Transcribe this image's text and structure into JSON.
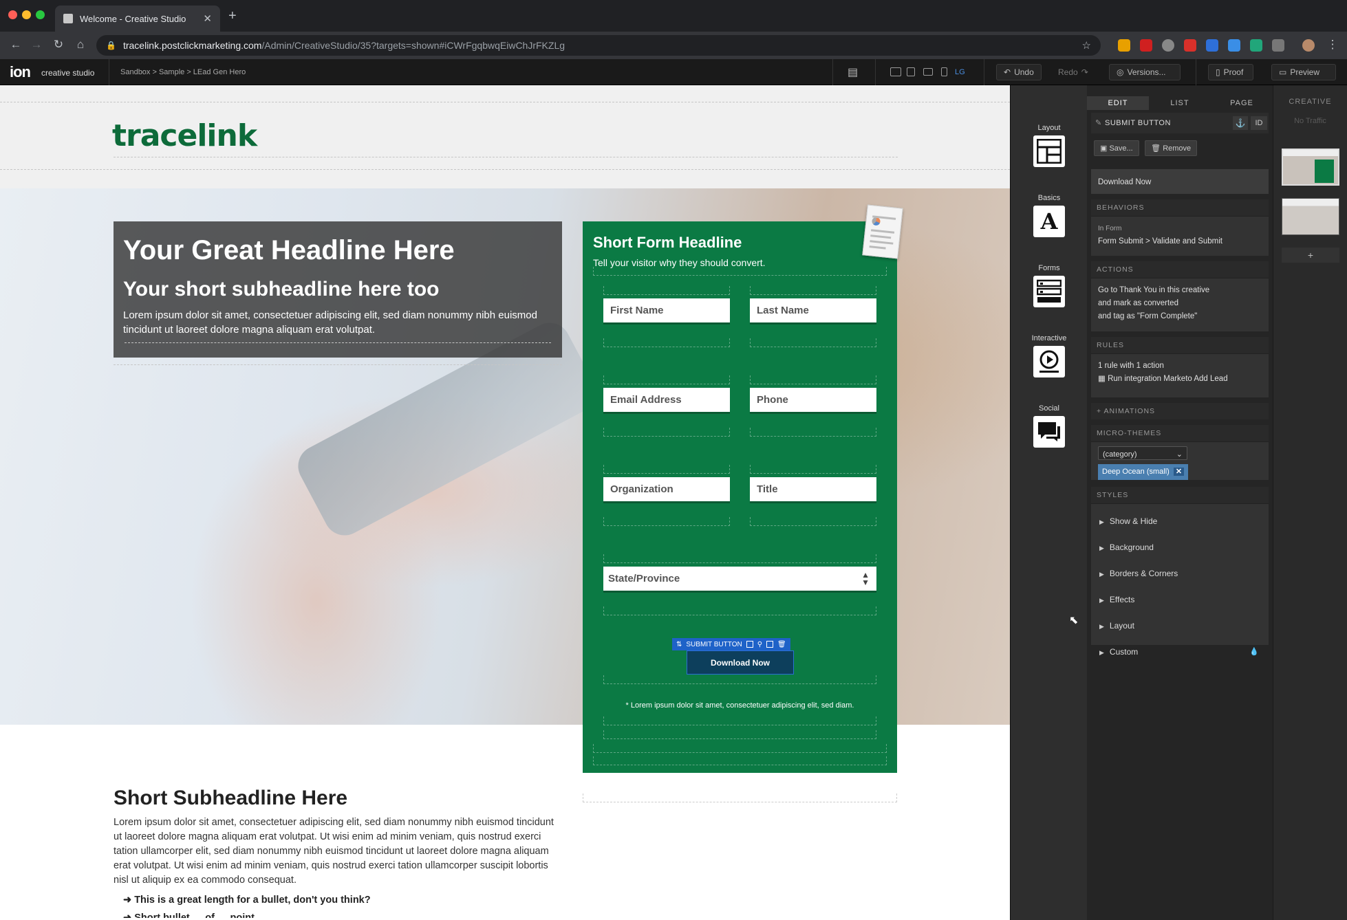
{
  "browser": {
    "tab_title": "Welcome - Creative Studio",
    "url_host": "tracelink.postclickmarketing.com",
    "url_path": "/Admin/CreativeStudio/35?targets=shown#iCWrFgqbwqEiwChJrFKZLg"
  },
  "toolbar": {
    "logo": "ion",
    "app_name": "creative studio",
    "breadcrumb": "Sandbox > Sample > LEad Gen Hero",
    "device_label": "LG",
    "undo": "Undo",
    "redo": "Redo",
    "versions": "Versions...",
    "proof": "Proof",
    "preview": "Preview"
  },
  "page": {
    "brand": "tracelink",
    "headline": "Your Great Headline Here",
    "subheadline": "Your short subheadline here too",
    "hero_body": "Lorem ipsum dolor sit amet, consectetuer adipiscing elit, sed diam nonummy nibh euismod tincidunt ut laoreet dolore magna aliquam erat volutpat.",
    "form": {
      "headline": "Short Form Headline",
      "subtext": "Tell your visitor why they should convert.",
      "fields": [
        "First Name",
        "Last Name",
        "Email Address",
        "Phone",
        "Organization",
        "Title"
      ],
      "state": "State/Province",
      "submit_label": "SUBMIT BUTTON",
      "submit": "Download Now",
      "disclaimer": "* Lorem ipsum dolor sit amet, consectetuer adipiscing elit, sed diam."
    },
    "section_heading": "Short Subheadline Here",
    "section_body": "Lorem ipsum dolor sit amet, consectetuer adipiscing elit, sed diam nonummy nibh euismod tincidunt ut laoreet dolore magna aliquam erat volutpat. Ut wisi enim ad minim veniam, quis nostrud exerci tation ullamcorper elit, sed diam nonummy nibh euismod tincidunt ut laoreet dolore magna aliquam erat volutpat. Ut wisi enim ad minim veniam, quis nostrud exerci tation ullamcorper suscipit lobortis nisl ut aliquip ex ea commodo consequat.",
    "bullet": "This is a great length for a bullet, don't you think?",
    "bullet2": "Short bullet … of … point …"
  },
  "palette": [
    "Layout",
    "Basics",
    "Forms",
    "Interactive",
    "Social"
  ],
  "panel": {
    "tabs": [
      "EDIT",
      "LIST",
      "PAGE"
    ],
    "element": "SUBMIT BUTTON",
    "id_label": "ID",
    "save": "Save...",
    "remove": "Remove",
    "button_text": "Download Now",
    "behaviors_h": "BEHAVIORS",
    "behavior_ctx": "In Form",
    "behavior": "Form Submit > Validate and Submit",
    "actions_h": "ACTIONS",
    "actions": [
      "Go to Thank You in this creative",
      "and mark as converted",
      "and tag as \"Form Complete\""
    ],
    "rules_h": "RULES",
    "rules_count": "1 rule with 1 action",
    "rule": "Run integration Marketo Add Lead",
    "animations": "+ ANIMATIONS",
    "themes_h": "MICRO-THEMES",
    "category": "(category)",
    "theme": "Deep Ocean (small)",
    "styles_h": "STYLES",
    "styles": [
      "Show & Hide",
      "Background",
      "Borders & Corners",
      "Effects",
      "Layout",
      "Custom"
    ]
  },
  "creative": {
    "title": "CREATIVE",
    "traffic": "No Traffic",
    "add": "+"
  },
  "colors": {
    "brand_green": "#0b7a44",
    "selection_blue": "#1e62c8"
  }
}
